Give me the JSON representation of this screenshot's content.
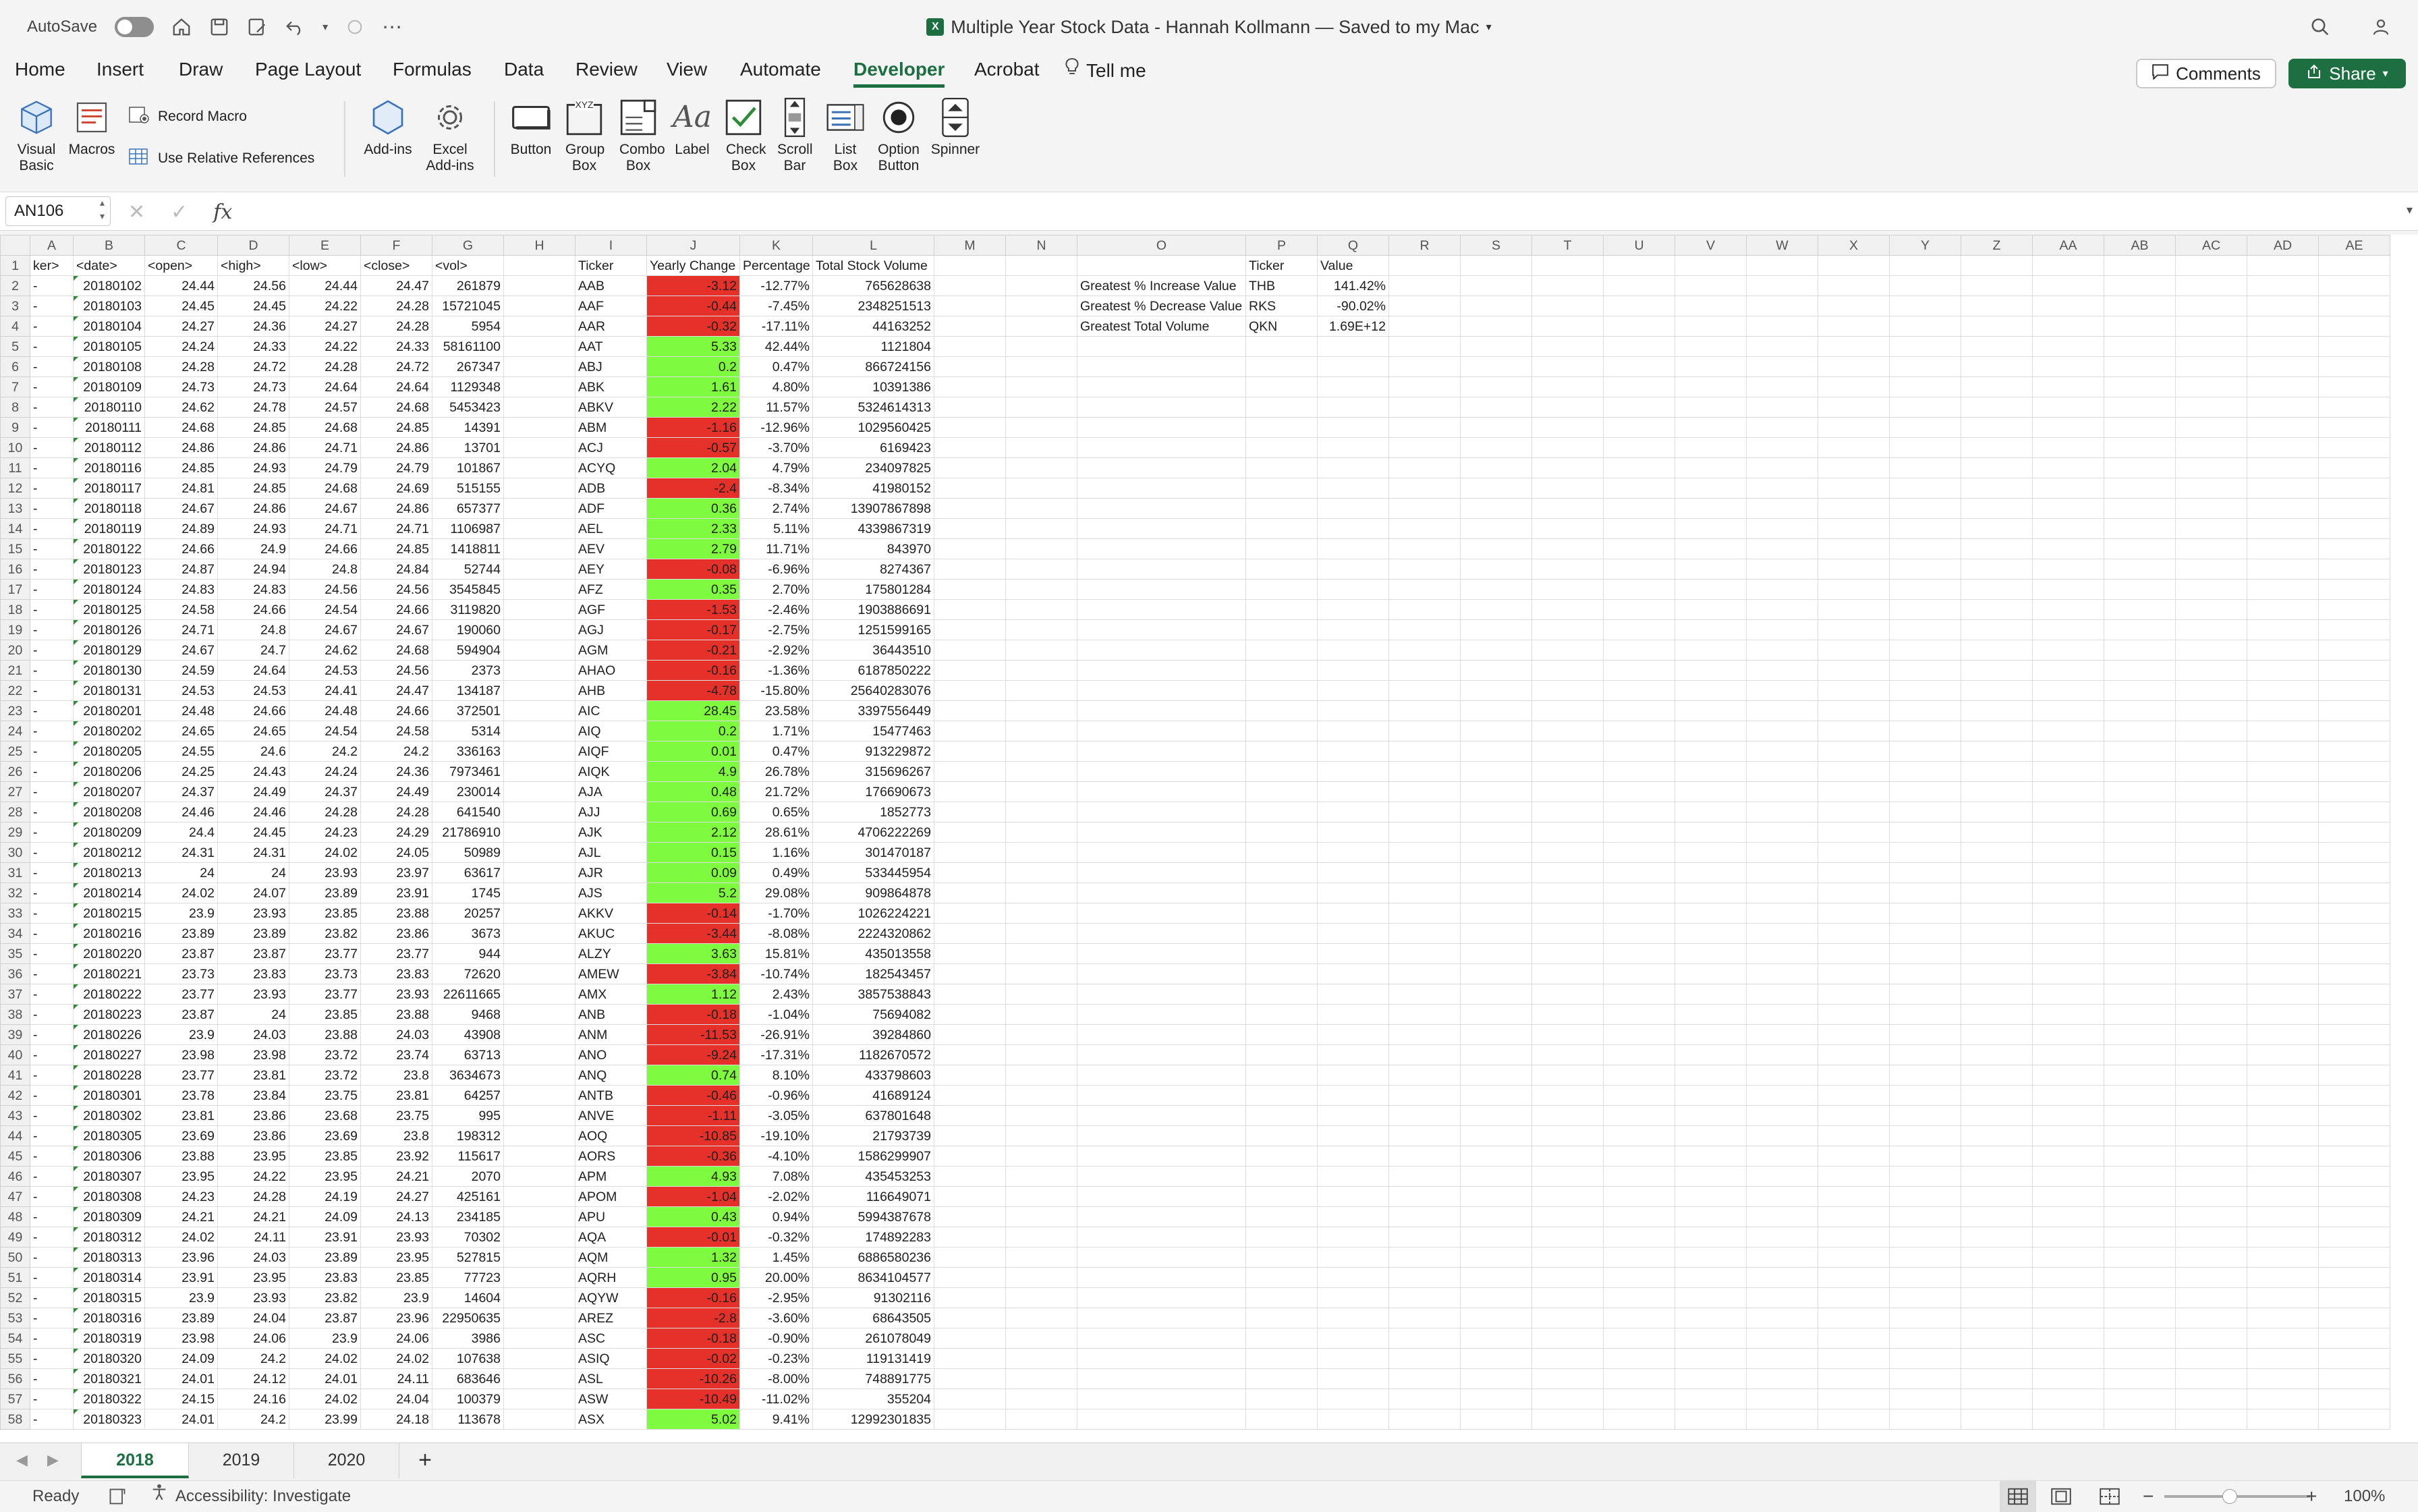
{
  "titlebar": {
    "autosave": "AutoSave",
    "title": "Multiple Year Stock Data - Hannah Kollmann — Saved to my Mac"
  },
  "menu": {
    "items": [
      "Home",
      "Insert",
      "Draw",
      "Page Layout",
      "Formulas",
      "Data",
      "Review",
      "View",
      "Automate",
      "Developer",
      "Acrobat",
      "Tell me"
    ],
    "active": "Developer",
    "comments": "Comments",
    "share": "Share"
  },
  "ribbon": {
    "visual_basic": "Visual Basic",
    "macros": "Macros",
    "record_macro": "Record Macro",
    "relative_refs": "Use Relative References",
    "addins": "Add-ins",
    "excel_addins": "Excel Add-ins",
    "button": "Button",
    "group_box": "Group Box",
    "combo_box": "Combo Box",
    "label": "Label",
    "check_box": "Check Box",
    "scroll_bar": "Scroll Bar",
    "list_box": "List Box",
    "option_button": "Option Button",
    "spinner": "Spinner"
  },
  "formula": {
    "namebox": "AN106",
    "fx": "fx",
    "value": ""
  },
  "columns": [
    "A",
    "B",
    "C",
    "D",
    "E",
    "F",
    "G",
    "H",
    "I",
    "J",
    "K",
    "L",
    "M",
    "N",
    "O",
    "P",
    "Q",
    "R",
    "S",
    "T",
    "U",
    "V",
    "W",
    "X",
    "Y",
    "Z",
    "AA",
    "AB",
    "AC",
    "AD",
    "AE"
  ],
  "header_row": [
    "ker>",
    "<date>",
    "<open>",
    "<high>",
    "<low>",
    "<close>",
    "<vol>",
    "",
    "Ticker",
    "Yearly Change",
    "Percentage",
    "Total Stock Volume"
  ],
  "summary": {
    "header": [
      "Ticker",
      "Value"
    ],
    "rows": [
      [
        "Greatest % Increase Value",
        "THB",
        "141.42%"
      ],
      [
        "Greatest % Decrease Value",
        "RKS",
        "-90.02%"
      ],
      [
        "Greatest Total Volume",
        "QKN",
        "1.69E+12"
      ]
    ]
  },
  "rows": [
    [
      "20180102",
      "24.44",
      "24.56",
      "24.44",
      "24.47",
      "261879",
      "AAB",
      "-3.12",
      "-12.77%",
      "765628638"
    ],
    [
      "20180103",
      "24.45",
      "24.45",
      "24.22",
      "24.28",
      "15721045",
      "AAF",
      "-0.44",
      "-7.45%",
      "2348251513"
    ],
    [
      "20180104",
      "24.27",
      "24.36",
      "24.27",
      "24.28",
      "5954",
      "AAR",
      "-0.32",
      "-17.11%",
      "44163252"
    ],
    [
      "20180105",
      "24.24",
      "24.33",
      "24.22",
      "24.33",
      "58161100",
      "AAT",
      "5.33",
      "42.44%",
      "1121804"
    ],
    [
      "20180108",
      "24.28",
      "24.72",
      "24.28",
      "24.72",
      "267347",
      "ABJ",
      "0.2",
      "0.47%",
      "866724156"
    ],
    [
      "20180109",
      "24.73",
      "24.73",
      "24.64",
      "24.64",
      "1129348",
      "ABK",
      "1.61",
      "4.80%",
      "10391386"
    ],
    [
      "20180110",
      "24.62",
      "24.78",
      "24.57",
      "24.68",
      "5453423",
      "ABKV",
      "2.22",
      "11.57%",
      "5324614313"
    ],
    [
      "20180111",
      "24.68",
      "24.85",
      "24.68",
      "24.85",
      "14391",
      "ABM",
      "-1.16",
      "-12.96%",
      "1029560425"
    ],
    [
      "20180112",
      "24.86",
      "24.86",
      "24.71",
      "24.86",
      "13701",
      "ACJ",
      "-0.57",
      "-3.70%",
      "6169423"
    ],
    [
      "20180116",
      "24.85",
      "24.93",
      "24.79",
      "24.79",
      "101867",
      "ACYQ",
      "2.04",
      "4.79%",
      "234097825"
    ],
    [
      "20180117",
      "24.81",
      "24.85",
      "24.68",
      "24.69",
      "515155",
      "ADB",
      "-2.4",
      "-8.34%",
      "41980152"
    ],
    [
      "20180118",
      "24.67",
      "24.86",
      "24.67",
      "24.86",
      "657377",
      "ADF",
      "0.36",
      "2.74%",
      "13907867898"
    ],
    [
      "20180119",
      "24.89",
      "24.93",
      "24.71",
      "24.71",
      "1106987",
      "AEL",
      "2.33",
      "5.11%",
      "4339867319"
    ],
    [
      "20180122",
      "24.66",
      "24.9",
      "24.66",
      "24.85",
      "1418811",
      "AEV",
      "2.79",
      "11.71%",
      "843970"
    ],
    [
      "20180123",
      "24.87",
      "24.94",
      "24.8",
      "24.84",
      "52744",
      "AEY",
      "-0.08",
      "-6.96%",
      "8274367"
    ],
    [
      "20180124",
      "24.83",
      "24.83",
      "24.56",
      "24.56",
      "3545845",
      "AFZ",
      "0.35",
      "2.70%",
      "175801284"
    ],
    [
      "20180125",
      "24.58",
      "24.66",
      "24.54",
      "24.66",
      "3119820",
      "AGF",
      "-1.53",
      "-2.46%",
      "1903886691"
    ],
    [
      "20180126",
      "24.71",
      "24.8",
      "24.67",
      "24.67",
      "190060",
      "AGJ",
      "-0.17",
      "-2.75%",
      "1251599165"
    ],
    [
      "20180129",
      "24.67",
      "24.7",
      "24.62",
      "24.68",
      "594904",
      "AGM",
      "-0.21",
      "-2.92%",
      "36443510"
    ],
    [
      "20180130",
      "24.59",
      "24.64",
      "24.53",
      "24.56",
      "2373",
      "AHAO",
      "-0.16",
      "-1.36%",
      "6187850222"
    ],
    [
      "20180131",
      "24.53",
      "24.53",
      "24.41",
      "24.47",
      "134187",
      "AHB",
      "-4.78",
      "-15.80%",
      "25640283076"
    ],
    [
      "20180201",
      "24.48",
      "24.66",
      "24.48",
      "24.66",
      "372501",
      "AIC",
      "28.45",
      "23.58%",
      "3397556449"
    ],
    [
      "20180202",
      "24.65",
      "24.65",
      "24.54",
      "24.58",
      "5314",
      "AIQ",
      "0.2",
      "1.71%",
      "15477463"
    ],
    [
      "20180205",
      "24.55",
      "24.6",
      "24.2",
      "24.2",
      "336163",
      "AIQF",
      "0.01",
      "0.47%",
      "913229872"
    ],
    [
      "20180206",
      "24.25",
      "24.43",
      "24.24",
      "24.36",
      "7973461",
      "AIQK",
      "4.9",
      "26.78%",
      "315696267"
    ],
    [
      "20180207",
      "24.37",
      "24.49",
      "24.37",
      "24.49",
      "230014",
      "AJA",
      "0.48",
      "21.72%",
      "176690673"
    ],
    [
      "20180208",
      "24.46",
      "24.46",
      "24.28",
      "24.28",
      "641540",
      "AJJ",
      "0.69",
      "0.65%",
      "1852773"
    ],
    [
      "20180209",
      "24.4",
      "24.45",
      "24.23",
      "24.29",
      "21786910",
      "AJK",
      "2.12",
      "28.61%",
      "4706222269"
    ],
    [
      "20180212",
      "24.31",
      "24.31",
      "24.02",
      "24.05",
      "50989",
      "AJL",
      "0.15",
      "1.16%",
      "301470187"
    ],
    [
      "20180213",
      "24",
      "24",
      "23.93",
      "23.97",
      "63617",
      "AJR",
      "0.09",
      "0.49%",
      "533445954"
    ],
    [
      "20180214",
      "24.02",
      "24.07",
      "23.89",
      "23.91",
      "1745",
      "AJS",
      "5.2",
      "29.08%",
      "909864878"
    ],
    [
      "20180215",
      "23.9",
      "23.93",
      "23.85",
      "23.88",
      "20257",
      "AKKV",
      "-0.14",
      "-1.70%",
      "1026224221"
    ],
    [
      "20180216",
      "23.89",
      "23.89",
      "23.82",
      "23.86",
      "3673",
      "AKUC",
      "-3.44",
      "-8.08%",
      "2224320862"
    ],
    [
      "20180220",
      "23.87",
      "23.87",
      "23.77",
      "23.77",
      "944",
      "ALZY",
      "3.63",
      "15.81%",
      "435013558"
    ],
    [
      "20180221",
      "23.73",
      "23.83",
      "23.73",
      "23.83",
      "72620",
      "AMEW",
      "-3.84",
      "-10.74%",
      "182543457"
    ],
    [
      "20180222",
      "23.77",
      "23.93",
      "23.77",
      "23.93",
      "22611665",
      "AMX",
      "1.12",
      "2.43%",
      "3857538843"
    ],
    [
      "20180223",
      "23.87",
      "24",
      "23.85",
      "23.88",
      "9468",
      "ANB",
      "-0.18",
      "-1.04%",
      "75694082"
    ],
    [
      "20180226",
      "23.9",
      "24.03",
      "23.88",
      "24.03",
      "43908",
      "ANM",
      "-11.53",
      "-26.91%",
      "39284860"
    ],
    [
      "20180227",
      "23.98",
      "23.98",
      "23.72",
      "23.74",
      "63713",
      "ANO",
      "-9.24",
      "-17.31%",
      "1182670572"
    ],
    [
      "20180228",
      "23.77",
      "23.81",
      "23.72",
      "23.8",
      "3634673",
      "ANQ",
      "0.74",
      "8.10%",
      "433798603"
    ],
    [
      "20180301",
      "23.78",
      "23.84",
      "23.75",
      "23.81",
      "64257",
      "ANTB",
      "-0.46",
      "-0.96%",
      "41689124"
    ],
    [
      "20180302",
      "23.81",
      "23.86",
      "23.68",
      "23.75",
      "995",
      "ANVE",
      "-1.11",
      "-3.05%",
      "637801648"
    ],
    [
      "20180305",
      "23.69",
      "23.86",
      "23.69",
      "23.8",
      "198312",
      "AOQ",
      "-10.85",
      "-19.10%",
      "21793739"
    ],
    [
      "20180306",
      "23.88",
      "23.95",
      "23.85",
      "23.92",
      "115617",
      "AORS",
      "-0.36",
      "-4.10%",
      "1586299907"
    ],
    [
      "20180307",
      "23.95",
      "24.22",
      "23.95",
      "24.21",
      "2070",
      "APM",
      "4.93",
      "7.08%",
      "435453253"
    ],
    [
      "20180308",
      "24.23",
      "24.28",
      "24.19",
      "24.27",
      "425161",
      "APOM",
      "-1.04",
      "-2.02%",
      "116649071"
    ],
    [
      "20180309",
      "24.21",
      "24.21",
      "24.09",
      "24.13",
      "234185",
      "APU",
      "0.43",
      "0.94%",
      "5994387678"
    ],
    [
      "20180312",
      "24.02",
      "24.11",
      "23.91",
      "23.93",
      "70302",
      "AQA",
      "-0.01",
      "-0.32%",
      "174892283"
    ],
    [
      "20180313",
      "23.96",
      "24.03",
      "23.89",
      "23.95",
      "527815",
      "AQM",
      "1.32",
      "1.45%",
      "6886580236"
    ],
    [
      "20180314",
      "23.91",
      "23.95",
      "23.83",
      "23.85",
      "77723",
      "AQRH",
      "0.95",
      "20.00%",
      "8634104577"
    ],
    [
      "20180315",
      "23.9",
      "23.93",
      "23.82",
      "23.9",
      "14604",
      "AQYW",
      "-0.16",
      "-2.95%",
      "91302116"
    ],
    [
      "20180316",
      "23.89",
      "24.04",
      "23.87",
      "23.96",
      "22950635",
      "AREZ",
      "-2.8",
      "-3.60%",
      "68643505"
    ],
    [
      "20180319",
      "23.98",
      "24.06",
      "23.9",
      "24.06",
      "3986",
      "ASC",
      "-0.18",
      "-0.90%",
      "261078049"
    ],
    [
      "20180320",
      "24.09",
      "24.2",
      "24.02",
      "24.02",
      "107638",
      "ASIQ",
      "-0.02",
      "-0.23%",
      "119131419"
    ],
    [
      "20180321",
      "24.01",
      "24.12",
      "24.01",
      "24.11",
      "683646",
      "ASL",
      "-10.26",
      "-8.00%",
      "748891775"
    ],
    [
      "20180322",
      "24.15",
      "24.16",
      "24.02",
      "24.04",
      "100379",
      "ASW",
      "-10.49",
      "-11.02%",
      "355204"
    ],
    [
      "20180323",
      "24.01",
      "24.2",
      "23.99",
      "24.18",
      "113678",
      "ASX",
      "5.02",
      "9.41%",
      "12992301835"
    ]
  ],
  "tabs": [
    "2018",
    "2019",
    "2020"
  ],
  "status": {
    "ready": "Ready",
    "accessibility": "Accessibility: Investigate",
    "zoom": "100%"
  }
}
